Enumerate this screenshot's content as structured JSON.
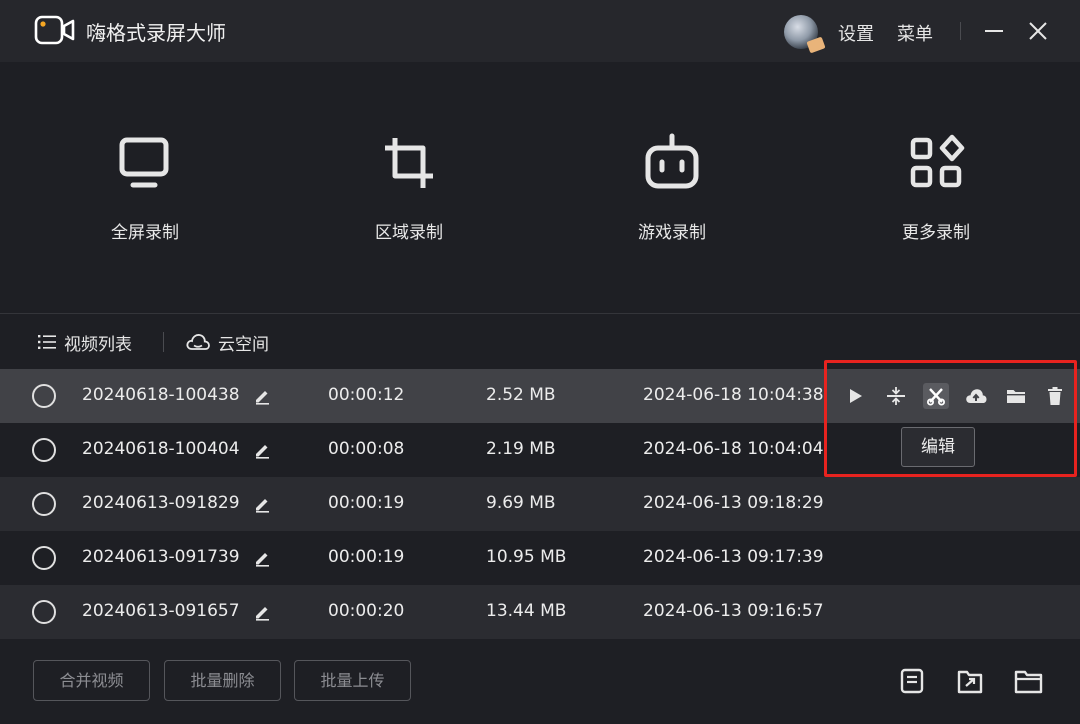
{
  "app": {
    "title": "嗨格式录屏大师",
    "settings_label": "设置",
    "menu_label": "菜单"
  },
  "modes": [
    {
      "label": "全屏录制",
      "icon": "monitor-icon"
    },
    {
      "label": "区域录制",
      "icon": "crop-icon"
    },
    {
      "label": "游戏录制",
      "icon": "gamepad-icon"
    },
    {
      "label": "更多录制",
      "icon": "apps-grid-icon"
    }
  ],
  "tabs": [
    {
      "label": "视频列表",
      "icon": "list-icon"
    },
    {
      "label": "云空间",
      "icon": "cloud-icon"
    }
  ],
  "videos": [
    {
      "name": "20240618-100438",
      "duration": "00:00:12",
      "size": "2.52 MB",
      "date": "2024-06-18 10:04:38"
    },
    {
      "name": "20240618-100404",
      "duration": "00:00:08",
      "size": "2.19 MB",
      "date": "2024-06-18 10:04:04"
    },
    {
      "name": "20240613-091829",
      "duration": "00:00:19",
      "size": "9.69 MB",
      "date": "2024-06-13 09:18:29"
    },
    {
      "name": "20240613-091739",
      "duration": "00:00:19",
      "size": "10.95 MB",
      "date": "2024-06-13 09:17:39"
    },
    {
      "name": "20240613-091657",
      "duration": "00:00:20",
      "size": "13.44 MB",
      "date": "2024-06-13 09:16:57"
    }
  ],
  "row_actions": [
    "play-icon",
    "split-icon",
    "edit-icon",
    "cloud-upload-icon",
    "folder-icon",
    "trash-icon"
  ],
  "tooltip": "编辑",
  "bottom": {
    "merge_label": "合并视频",
    "batch_delete_label": "批量删除",
    "batch_upload_label": "批量上传",
    "icons": [
      "import-icon",
      "export-icon",
      "open-folder-icon"
    ]
  },
  "colors": {
    "highlight": "#e8231f",
    "accent_dot": "#f5a623"
  }
}
